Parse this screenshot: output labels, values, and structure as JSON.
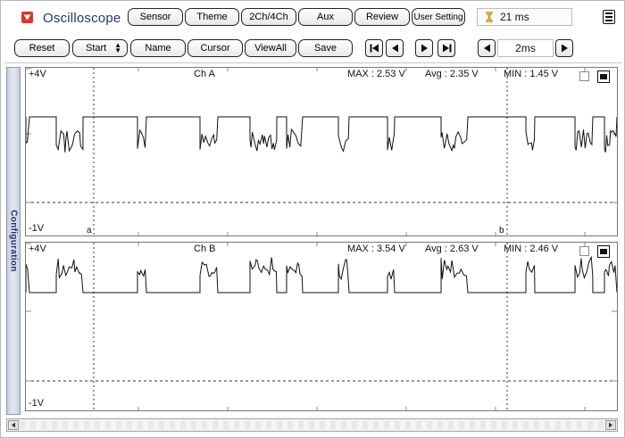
{
  "app": {
    "title": "Oscilloscope",
    "menu_icon": "red-dropdown-icon"
  },
  "toolbar_top": {
    "buttons": [
      "Sensor",
      "Theme",
      "2Ch/4Ch",
      "Aux",
      "Review",
      "User Setting"
    ],
    "timer_icon": "hourglass-icon",
    "timer_value": "21 ms"
  },
  "toolbar_second": {
    "reset": "Reset",
    "start": "Start",
    "name": "Name",
    "cursor": "Cursor",
    "viewall": "ViewAll",
    "save": "Save",
    "timebase": "2ms"
  },
  "sidebar": {
    "label": "Configuration"
  },
  "channels": [
    {
      "name": "Ch A",
      "top_label": "+4V",
      "bottom_label": "-1V",
      "max_label": "MAX : 2.53 V",
      "avg_label": "Avg : 2.35 V",
      "min_label": "MIN : 1.45 V",
      "cursor_a": "a",
      "cursor_b": "b"
    },
    {
      "name": "Ch B",
      "top_label": "+4V",
      "bottom_label": "-1V",
      "max_label": "MAX : 3.54 V",
      "avg_label": "Avg : 2.63 V",
      "min_label": "MIN : 2.46 V"
    }
  ],
  "colors": {
    "title": "#1f3a6b",
    "menu_icon": "#d8382c",
    "sidebar_text": "#1f2f6b"
  }
}
